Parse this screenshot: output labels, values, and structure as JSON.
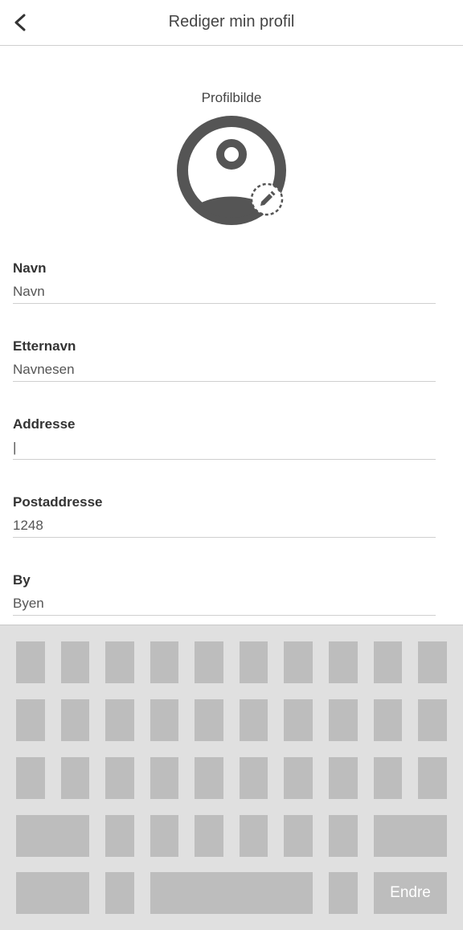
{
  "header": {
    "title": "Rediger min profil",
    "back_icon": "chevron-left-icon"
  },
  "avatar": {
    "label": "Profilbilde",
    "icon": "account-circle-icon",
    "edit_icon": "pencil-icon"
  },
  "fields": [
    {
      "label": "Navn",
      "value": "Navn"
    },
    {
      "label": "Etternavn",
      "value": "Navnesen"
    },
    {
      "label": "Addresse",
      "value": "|"
    },
    {
      "label": "Postaddresse",
      "value": "1248"
    },
    {
      "label": "By",
      "value": "Byen"
    }
  ],
  "keyboard": {
    "submit_label": "Endre"
  },
  "colors": {
    "icon": "#555555",
    "key": "#bdbdbd",
    "keyboard_bg": "#e0e0e0",
    "divider": "#cfcfcf"
  }
}
